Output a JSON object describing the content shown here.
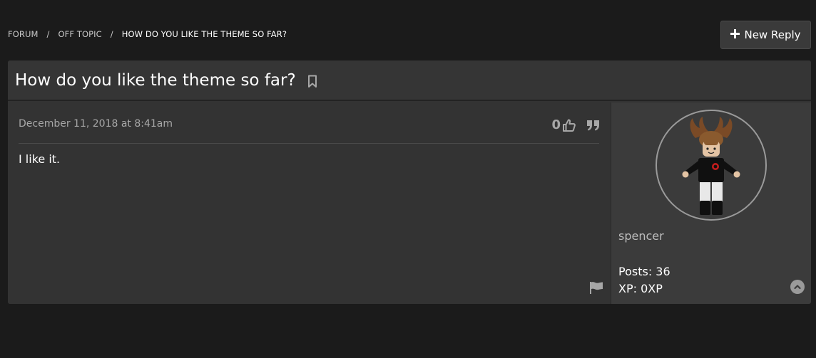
{
  "breadcrumb": {
    "items": [
      "FORUM",
      "OFF TOPIC",
      "HOW DO YOU LIKE THE THEME SO FAR?"
    ],
    "separator": "/"
  },
  "toolbar": {
    "new_reply_label": "New Reply",
    "new_reply_icon": "plus-icon"
  },
  "thread": {
    "title": "How do you like the theme so far?",
    "bookmark_icon": "bookmark-icon"
  },
  "post": {
    "date": "December 11, 2018 at 8:41am",
    "likes": "0",
    "body": "I like it.",
    "icons": [
      "thumbs-up-icon",
      "quote-icon",
      "flag-icon"
    ]
  },
  "author": {
    "username": "spencer",
    "posts": "Posts: 36",
    "xp": "XP: 0XP"
  },
  "colors": {
    "page_bg": "#1b1b1b",
    "panel_bg": "#333333",
    "author_bg": "#3b3b3b",
    "button_bg": "#3a3a3a",
    "muted_text": "#a7a7a7"
  }
}
